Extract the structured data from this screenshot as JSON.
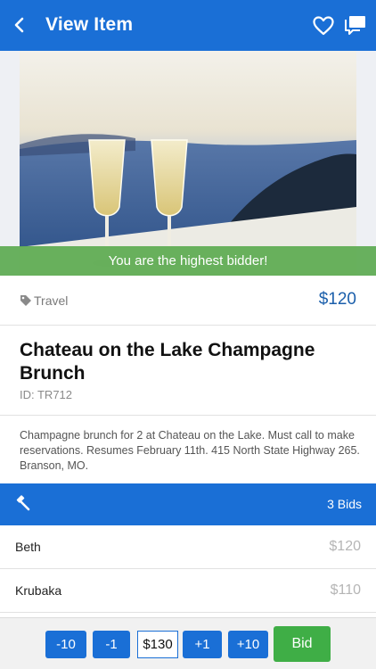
{
  "header": {
    "title": "View Item",
    "back_icon": "chevron-left-icon",
    "favorite_icon": "heart-outline-icon",
    "messages_icon": "chat-icon",
    "background_color": "#1a6fd6"
  },
  "hero": {
    "banner_text": "You are the highest bidder!",
    "banner_color": "#5caa50"
  },
  "item": {
    "category": "Travel",
    "category_icon": "tag-icon",
    "price": "$120",
    "title": "Chateau on the Lake Champagne Brunch",
    "id": "ID: TR712",
    "description": "Champagne brunch for 2 at Chateau on the Lake. Must call to make reservations. Resumes February 11th. 415 North State Highway 265. Branson, MO."
  },
  "bids": {
    "icon": "gavel-icon",
    "count": "3 Bids",
    "rows": [
      {
        "name": "Beth",
        "amount": "$120"
      },
      {
        "name": "Krubaka",
        "amount": "$110"
      }
    ]
  },
  "footer": {
    "minus10": "-10",
    "minus1": "-1",
    "amount": "$130",
    "plus1": "+1",
    "plus10": "+10",
    "bid": "Bid",
    "bid_color": "#3fae46"
  }
}
